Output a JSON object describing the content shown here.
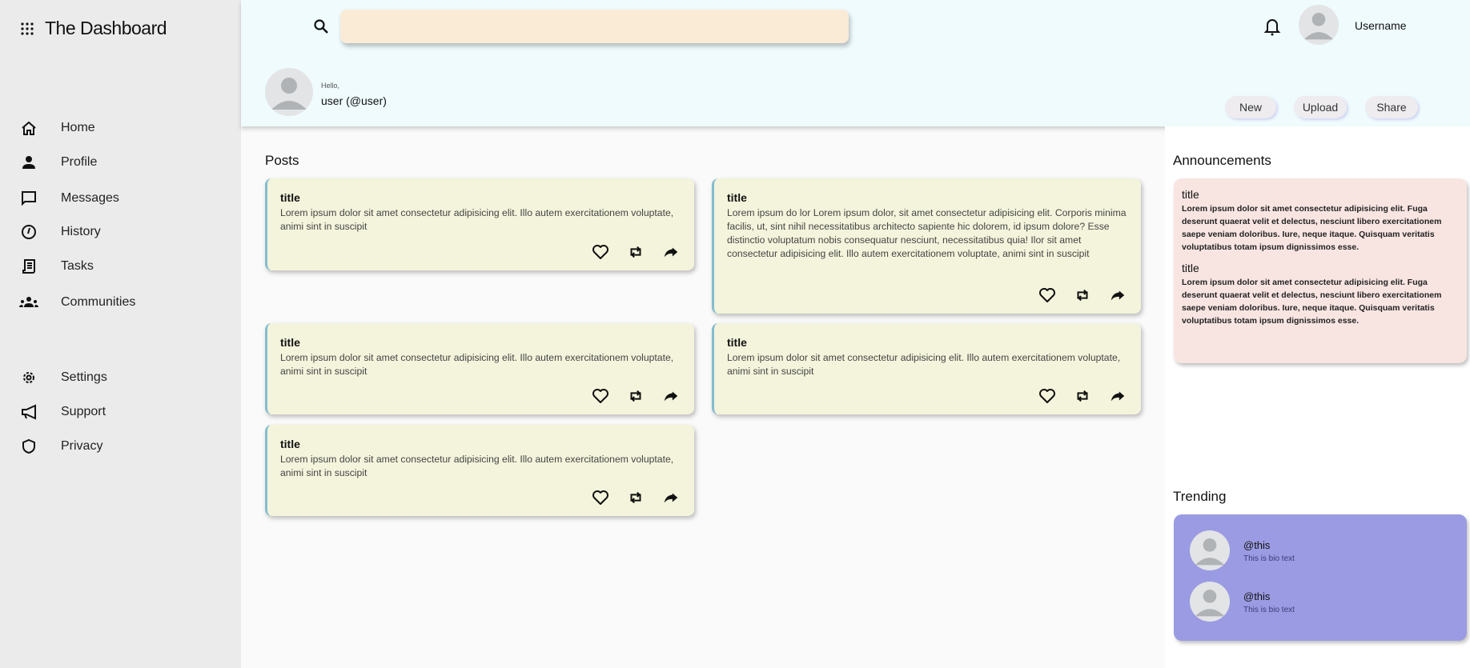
{
  "app": {
    "title": "The Dashboard"
  },
  "sidebar": {
    "items": [
      {
        "label": "Home",
        "icon": "home-icon"
      },
      {
        "label": "Profile",
        "icon": "person-icon"
      },
      {
        "label": "Messages",
        "icon": "chat-icon"
      },
      {
        "label": "History",
        "icon": "clock-icon"
      },
      {
        "label": "Tasks",
        "icon": "scroll-icon"
      },
      {
        "label": "Communities",
        "icon": "group-icon"
      },
      {
        "label": "Settings",
        "icon": "gear-icon"
      },
      {
        "label": "Support",
        "icon": "megaphone-icon"
      },
      {
        "label": "Privacy",
        "icon": "shield-icon"
      }
    ]
  },
  "header": {
    "search_value": "",
    "username": "Username",
    "greeting": "Hello,",
    "user_handle": "user (@user)",
    "buttons": {
      "new": "New",
      "upload": "Upload",
      "share": "Share"
    }
  },
  "posts": {
    "heading": "Posts",
    "items": [
      {
        "title": "title",
        "body": "Lorem ipsum dolor sit amet consectetur adipisicing elit. Illo autem exercitationem voluptate, animi sint in suscipit"
      },
      {
        "title": "title",
        "body": "Lorem ipsum do lor Lorem ipsum dolor, sit amet consectetur adipisicing elit. Corporis minima facilis, ut, sint nihil necessitatibus architecto sapiente hic dolorem, id ipsum dolore? Esse distinctio voluptatum nobis consequatur nesciunt, necessitatibus quia! Ilor sit amet consectetur adipisicing elit. Illo autem exercitationem voluptate, animi sint in suscipit"
      },
      {
        "title": "title",
        "body": "Lorem ipsum dolor sit amet consectetur adipisicing elit. Illo autem exercitationem voluptate, animi sint in suscipit"
      },
      {
        "title": "title",
        "body": "Lorem ipsum dolor sit amet consectetur adipisicing elit. Illo autem exercitationem voluptate, animi sint in suscipit"
      },
      {
        "title": "title",
        "body": "Lorem ipsum dolor sit amet consectetur adipisicing elit. Illo autem exercitationem voluptate, animi sint in suscipit"
      }
    ]
  },
  "announcements": {
    "heading": "Announcements",
    "items": [
      {
        "title": "title",
        "body": "Lorem ipsum dolor sit amet consectetur adipisicing elit. Fuga deserunt quaerat velit et delectus, nesciunt libero exercitationem saepe veniam doloribus. Iure, neque itaque. Quisquam veritatis voluptatibus totam ipsum dignissimos esse."
      },
      {
        "title": "title",
        "body": "Lorem ipsum dolor sit amet consectetur adipisicing elit. Fuga deserunt quaerat velit et delectus, nesciunt libero exercitationem saepe veniam doloribus. Iure, neque itaque. Quisquam veritatis voluptatibus totam ipsum dignissimos esse."
      }
    ]
  },
  "trending": {
    "heading": "Trending",
    "items": [
      {
        "handle": "@this",
        "bio": "This is bio text"
      },
      {
        "handle": "@this",
        "bio": "This is bio text"
      }
    ]
  },
  "colors": {
    "sidebar": "#ebebeb",
    "header": "#effbfd",
    "search": "#faebd7",
    "post": "#f4f4dc",
    "announcement": "#f8e5e2",
    "trending": "#9b9be3"
  }
}
